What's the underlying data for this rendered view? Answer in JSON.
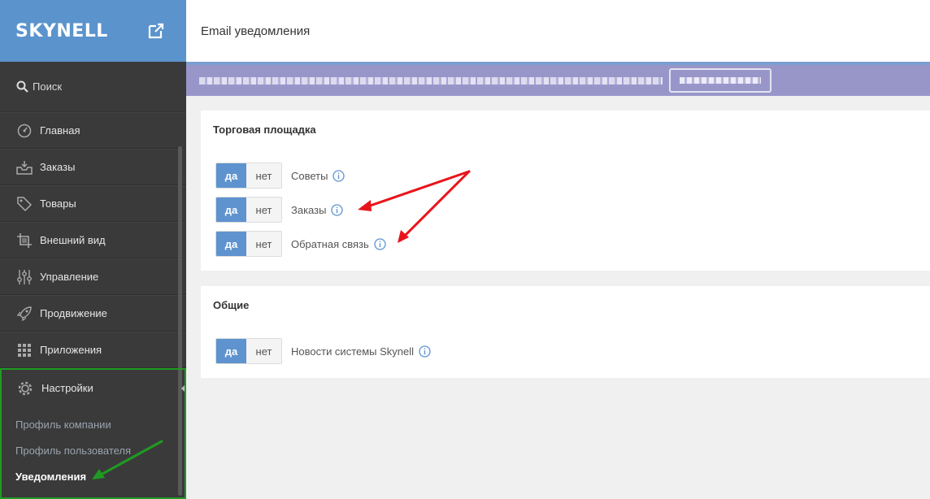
{
  "sidebar": {
    "logo": "SKYNELL",
    "search_label": "Поиск",
    "items": [
      {
        "label": "Главная",
        "icon": "speedometer-icon"
      },
      {
        "label": "Заказы",
        "icon": "inbox-icon"
      },
      {
        "label": "Товары",
        "icon": "tag-icon"
      },
      {
        "label": "Внешний вид",
        "icon": "crop-icon"
      },
      {
        "label": "Управление",
        "icon": "sliders-icon"
      },
      {
        "label": "Продвижение",
        "icon": "rocket-icon"
      },
      {
        "label": "Приложения",
        "icon": "grid-icon"
      }
    ],
    "settings": {
      "label": "Настройки",
      "icon": "gear-icon",
      "subitems": [
        {
          "label": "Профиль компании"
        },
        {
          "label": "Профиль пользователя"
        },
        {
          "label": "Уведомления",
          "active": true
        }
      ]
    }
  },
  "header": {
    "title": "Email уведомления"
  },
  "sections": [
    {
      "title": "Торговая площадка",
      "rows": [
        {
          "yes": "да",
          "no": "нет",
          "label": "Советы",
          "value": "да"
        },
        {
          "yes": "да",
          "no": "нет",
          "label": "Заказы",
          "value": "да"
        },
        {
          "yes": "да",
          "no": "нет",
          "label": "Обратная связь",
          "value": "да"
        }
      ]
    },
    {
      "title": "Общие",
      "rows": [
        {
          "yes": "да",
          "no": "нет",
          "label": "Новости системы Skynell",
          "value": "да"
        }
      ]
    }
  ],
  "colors": {
    "accent": "#5e93cf",
    "logo_bar": "#5b93cc",
    "sidebar_bg": "#3a3a3a",
    "banner": "#9896c9",
    "highlight_green": "#1f9a22",
    "arrow_red": "#e8141b"
  }
}
